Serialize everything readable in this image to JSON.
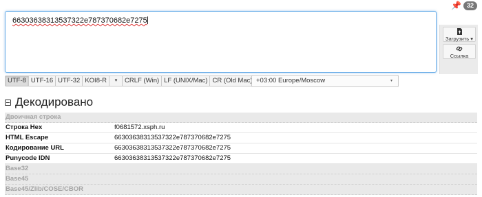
{
  "badge": {
    "count": "32",
    "pin_icon": "pin-icon"
  },
  "input": {
    "value": "66303638313537322e787370682e7275"
  },
  "side_panel": {
    "upload_label": "Загрузить",
    "upload_arrow": "▾",
    "link_label": "Ссылка",
    "upload_icon": "file-upload-icon",
    "link_icon": "link-icon"
  },
  "encodings": {
    "items": [
      "UTF-8",
      "UTF-16",
      "UTF-32",
      "KOI8-R"
    ],
    "active": "UTF-8",
    "more": "▾"
  },
  "line_endings": {
    "items": [
      "CRLF (Win)",
      "LF (UNIX/Mac)",
      "CR (Old Mac)"
    ]
  },
  "timezone": {
    "selected": "+03:00 Europe/Moscow",
    "arrow": "▾"
  },
  "decoded": {
    "title": "Декодировано",
    "rows": [
      {
        "type": "group",
        "label": "Двоичная строка"
      },
      {
        "type": "data",
        "label": "Строка Hex",
        "value": "f0681572.xsph.ru"
      },
      {
        "type": "data",
        "label": "HTML Escape",
        "value": "66303638313537322e787370682e7275"
      },
      {
        "type": "data",
        "label": "Кодирование URL",
        "value": "66303638313537322e787370682e7275"
      },
      {
        "type": "data",
        "label": "Punycode IDN",
        "value": "66303638313537322e787370682e7275"
      },
      {
        "type": "group",
        "label": "Base32"
      },
      {
        "type": "group",
        "label": "Base45"
      },
      {
        "type": "group",
        "label": "Base45/Zlib/COSE/CBOR"
      }
    ]
  }
}
